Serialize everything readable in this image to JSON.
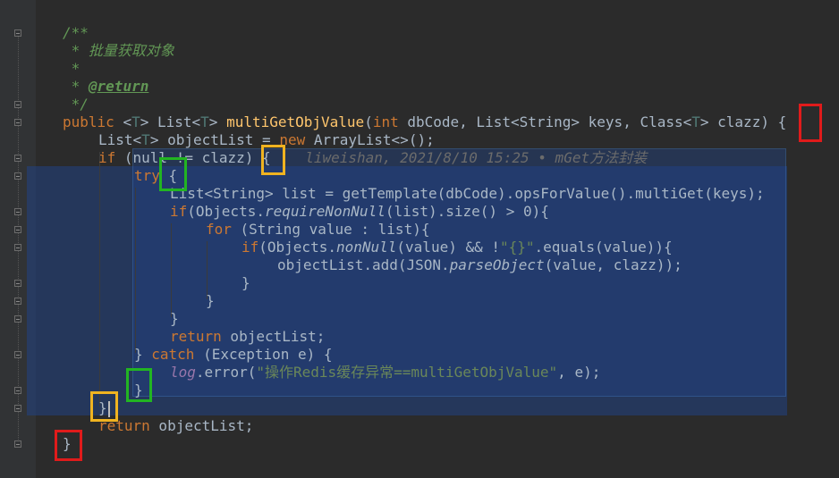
{
  "code": {
    "l1": "/**",
    "l2_star": " * ",
    "l2_text": "批量获取对象",
    "l3": " *",
    "l4_star": " * ",
    "l4_tag": "@return",
    "l5": " */",
    "l6": {
      "public": "public ",
      "lt1": "<",
      "T1": "T",
      "gt1": "> ",
      "list": "List<",
      "T2": "T",
      "gt2": "> ",
      "name": "multiGetObjValue",
      "paren": "(",
      "int": "int",
      "rest1": " dbCode, List<String> keys, Class<",
      "T3": "T",
      "rest2": "> clazz) ",
      "brace": "{"
    },
    "l7": {
      "list": "List<",
      "T": "T",
      "rest1": "> objectList = ",
      "new": "new",
      "rest2": " ArrayList<>();"
    },
    "l8": {
      "if": "if",
      "rest": " (null != clazz) ",
      "brace": "{",
      "hint": "liweishan, 2021/8/10 15:25 • mGet方法封装"
    },
    "l9": {
      "try": "try",
      "brace": " {"
    },
    "l10": "List<String> list = getTemplate(dbCode).opsForValue().multiGet(keys);",
    "l11": {
      "if": "if",
      "p1": "(Objects.",
      "m": "requireNonNull",
      "p2": "(list).size() > 0){"
    },
    "l12": {
      "for": "for",
      "p": " (String value : list){"
    },
    "l13": {
      "if": "if",
      "p1": "(Objects.",
      "m": "nonNull",
      "p2": "(value) && !",
      "s": "\"{}\"",
      "p3": ".equals(value)){"
    },
    "l14": {
      "p1": "objectList.add(JSON.",
      "m": "parseObject",
      "p2": "(value, clazz));"
    },
    "l15": "}",
    "l16": "}",
    "l17": "}",
    "l18": {
      "return": "return",
      "p": " objectList;"
    },
    "l19": {
      "close": "} ",
      "catch": "catch",
      "p": " (Exception e) {"
    },
    "l20": {
      "log": "log",
      "p1": ".error(",
      "s": "\"操作Redis缓存异常==multiGetObjValue\"",
      "p2": ", e);"
    },
    "l21": "}",
    "l22": "}",
    "l23": {
      "return": "return",
      "p": " objectList;"
    },
    "l24": "}"
  },
  "annotations": {
    "red": "#e01b1b",
    "orange": "#f0b320",
    "green": "#22b522"
  },
  "colors": {
    "background": "#2b2b2b",
    "gutter": "#313335",
    "keyword": "#cc7832",
    "method": "#ffc66d",
    "comment": "#629755",
    "string": "#6a8759",
    "selection": "#214283"
  }
}
